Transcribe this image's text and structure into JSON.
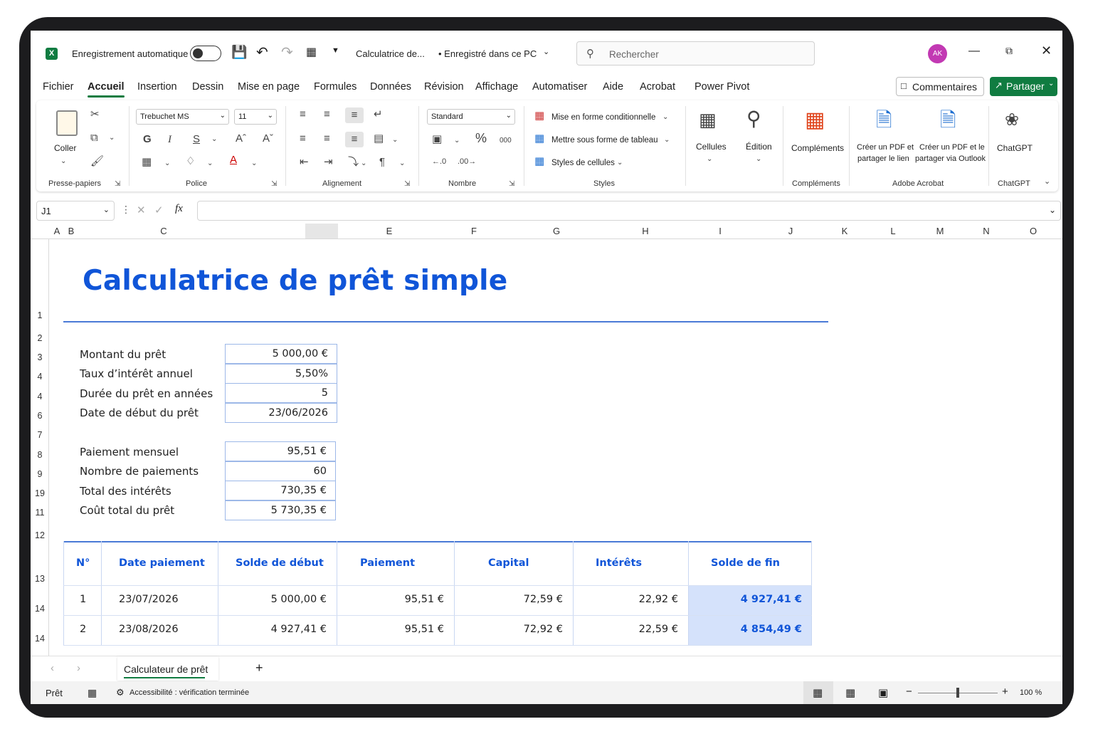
{
  "titlebar": {
    "autosave_label": "Enregistrement automatique",
    "doc_title": "Calculatrice de...",
    "save_status": "• Enregistré dans ce PC",
    "search_placeholder": "Rechercher",
    "avatar_initials": "AK"
  },
  "menu": {
    "tabs": [
      "Fichier",
      "Accueil",
      "Insertion",
      "Dessin",
      "Mise en page",
      "Formules",
      "Données",
      "Révision",
      "Affichage",
      "Automatiser",
      "Aide",
      "Acrobat",
      "Power Pivot"
    ],
    "active": "Accueil",
    "comments_label": "Commentaires",
    "share_label": "Partager"
  },
  "ribbon": {
    "paste_label": "Coller",
    "font_name": "Trebuchet MS",
    "font_size": "11",
    "number_format": "Standard",
    "bold": "G",
    "italic": "I",
    "underline": "S",
    "percent": "%",
    "thousands": "000",
    "cond_format": "Mise en forme conditionnelle",
    "format_table": "Mettre sous forme de tableau",
    "cell_styles": "Styles de cellules",
    "cells": "Cellules",
    "edition": "Édition",
    "addins": "Compléments",
    "pdf_link_1": "Créer un PDF et",
    "pdf_link_2": "partager le lien",
    "pdf_outlook_1": "Créer un PDF et le",
    "pdf_outlook_2": "partager via Outlook",
    "chatgpt": "ChatGPT",
    "groups": {
      "clipboard": "Presse-papiers",
      "font": "Police",
      "alignment": "Alignement",
      "number": "Nombre",
      "styles": "Styles",
      "addins": "Compléments",
      "acrobat": "Adobe Acrobat",
      "chatgpt": "ChatGPT"
    }
  },
  "formula_bar": {
    "name_box": "J1",
    "fx": "fx",
    "content": ""
  },
  "columns": [
    "A",
    "B",
    "C",
    "E",
    "F",
    "G",
    "H",
    "I",
    "J",
    "K",
    "L",
    "M",
    "N",
    "O"
  ],
  "rows": [
    "1",
    "2",
    "3",
    "4",
    "4",
    "6",
    "7",
    "8",
    "9",
    "19",
    "11",
    "12",
    "13",
    "14",
    "14"
  ],
  "sheet": {
    "title": "Calculatrice  de prêt simple",
    "inputs": [
      {
        "label": "Montant du prêt",
        "value": "5 000,00 €"
      },
      {
        "label": "Taux d’intérêt annuel",
        "value": "5,50%"
      },
      {
        "label": "Durée du prêt en années",
        "value": "5"
      },
      {
        "label": "Date de début du prêt",
        "value": "23/06/2026"
      }
    ],
    "results": [
      {
        "label": "Paiement mensuel",
        "value": "95,51 €"
      },
      {
        "label": "Nombre de paiements",
        "value": "60"
      },
      {
        "label": "Total des intérêts",
        "value": "730,35 €"
      },
      {
        "label": "Coût total du prêt",
        "value": "5 730,35 €"
      }
    ],
    "table": {
      "headers": [
        "N°",
        "Date paiement",
        "Solde de début",
        "Paiement",
        "Capital",
        "Intérêts",
        "Solde de fin"
      ],
      "rows": [
        [
          "1",
          "23/07/2026",
          "5 000,00 €",
          "95,51 €",
          "72,59 €",
          "22,92 €",
          "4 927,41 €"
        ],
        [
          "2",
          "23/08/2026",
          "4 927,41 €",
          "95,51 €",
          "72,92 €",
          "22,59 €",
          "4 854,49 €"
        ]
      ]
    }
  },
  "sheet_tabs": {
    "active": "Calculateur de prêt",
    "add": "+"
  },
  "status": {
    "ready": "Prêt",
    "accessibility": "Accessibilité : vérification terminée",
    "zoom": "100 %"
  },
  "colors": {
    "accent": "#107c41",
    "title_blue": "#1055d8",
    "highlight": "#d5e2fb"
  }
}
